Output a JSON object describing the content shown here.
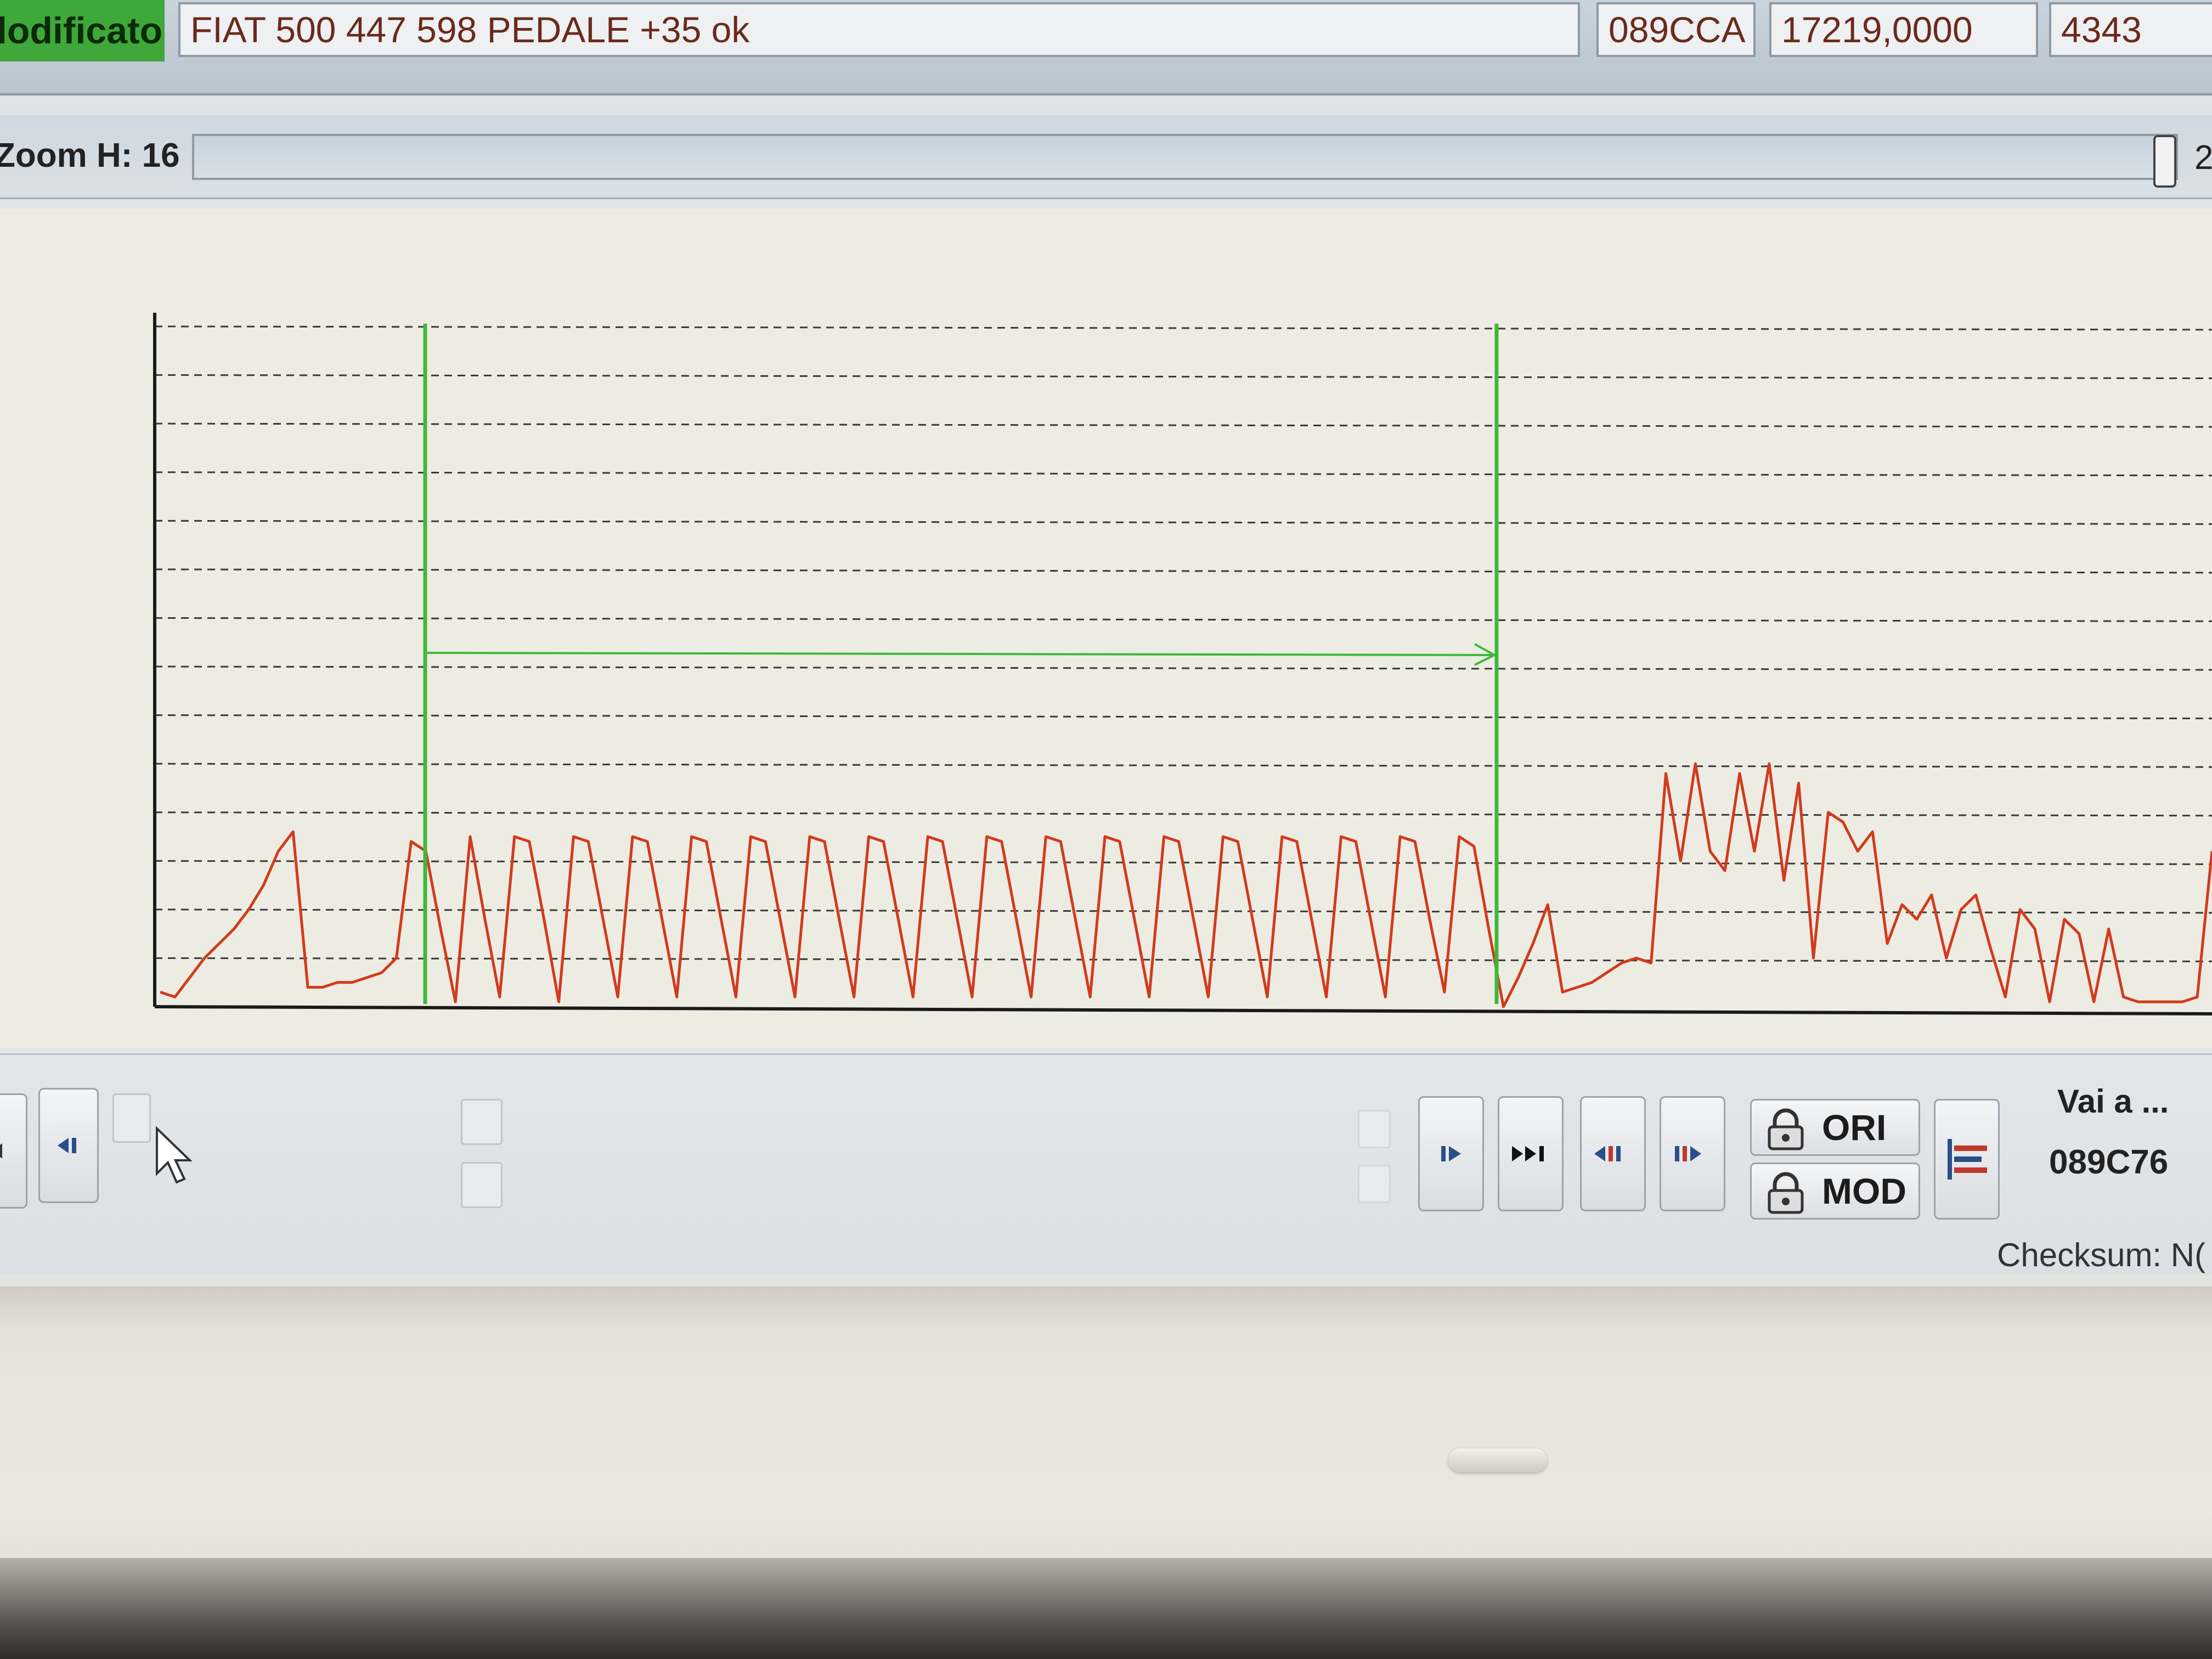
{
  "header": {
    "status_label": "lodificato",
    "file_name": "FIAT 500 447 598 PEDALE +35 ok",
    "address": "089CCA",
    "value": "17219,0000",
    "extra": "4343"
  },
  "zoom": {
    "label": "Zoom H: 16",
    "level": 16
  },
  "toolbar": {
    "ori_label": "ORI",
    "mod_label": "MOD",
    "goto_label": "Vai a ...",
    "goto_value": "089C76",
    "checksum_label": "Checksum: N("
  },
  "icons": {
    "left_arrow": "arrow-left-icon",
    "step_back": "step-back-icon",
    "next": "next-icon",
    "skip_end": "skip-end-icon",
    "prev_marker": "prev-marker-icon",
    "next_marker": "next-marker-icon",
    "lock": "lock-icon",
    "chart_tool": "chart-tool-icon",
    "cursor": "mouse-cursor-icon"
  },
  "colors": {
    "status_green": "#3ea83a",
    "signal_red": "#d23a1c",
    "marker_green": "#3fb83a"
  },
  "chart_data": {
    "type": "line",
    "title": "",
    "xlabel": "",
    "ylabel": "",
    "ylim": [
      0,
      14
    ],
    "grid": "horizontal dashed",
    "series": [
      {
        "values": [
          0.3,
          0.2,
          0.6,
          1.0,
          1.3,
          1.6,
          2.0,
          2.5,
          3.2,
          3.6,
          0.4,
          0.4,
          0.5,
          0.5,
          0.6,
          0.7,
          1.0,
          3.4,
          3.2,
          1.6,
          0.1,
          3.5,
          1.8,
          0.2,
          3.5,
          3.4,
          1.8,
          0.1,
          3.5,
          3.4,
          1.8,
          0.2,
          3.5,
          3.4,
          1.8,
          0.2,
          3.5,
          3.4,
          1.8,
          0.2,
          3.5,
          3.4,
          1.8,
          0.2,
          3.5,
          3.4,
          1.8,
          0.2,
          3.5,
          3.4,
          1.8,
          0.2,
          3.5,
          3.4,
          1.8,
          0.2,
          3.5,
          3.4,
          1.8,
          0.2,
          3.5,
          3.4,
          1.8,
          0.2,
          3.5,
          3.4,
          1.8,
          0.2,
          3.5,
          3.4,
          1.8,
          0.2,
          3.5,
          3.4,
          1.8,
          0.2,
          3.5,
          3.4,
          1.8,
          0.2,
          3.5,
          3.4,
          1.8,
          0.2,
          3.5,
          3.4,
          1.8,
          0.3,
          3.5,
          3.3,
          1.6,
          0.0,
          0.6,
          1.3,
          2.1,
          0.3,
          0.4,
          0.5,
          0.7,
          0.9,
          1.0,
          0.9,
          4.8,
          3.0,
          5.0,
          3.2,
          2.8,
          4.8,
          3.2,
          5.0,
          2.6,
          4.6,
          1.0,
          4.0,
          3.8,
          3.2,
          3.6,
          1.3,
          2.1,
          1.8,
          2.3,
          1.0,
          2.0,
          2.3,
          1.2,
          0.2,
          2.0,
          1.6,
          0.1,
          1.8,
          1.5,
          0.1,
          1.6,
          0.2,
          0.1,
          0.1,
          0.1,
          0.1,
          0.2,
          3.2
        ]
      }
    ],
    "markers": [
      "start",
      "end"
    ]
  }
}
